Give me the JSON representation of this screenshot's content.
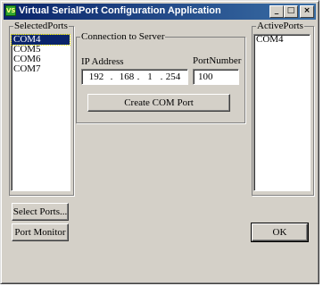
{
  "window": {
    "title": "Virtual SerialPort Configuration Application",
    "icon_text": "VS"
  },
  "title_buttons": {
    "minimize": "_",
    "maximize": "□",
    "close": "×"
  },
  "selected_ports": {
    "label": "SelectedPorts",
    "items": [
      "COM4",
      "COM5",
      "COM6",
      "COM7"
    ],
    "selected_index": 0
  },
  "connection": {
    "label": "Connection to Server",
    "ip_label": "IP Address",
    "ip": [
      "192",
      "168",
      "1",
      "254"
    ],
    "ip_dot": ".",
    "port_label": "PortNumber",
    "port": "100",
    "create_button": "Create COM Port"
  },
  "active_ports": {
    "label": "ActivePorts",
    "items": [
      "COM4"
    ]
  },
  "buttons": {
    "select_ports": "Select Ports...",
    "port_monitor": "Port Monitor",
    "ok": "OK"
  },
  "colors": {
    "face": "#d4d0c8",
    "title_start": "#0a246a",
    "title_end": "#3a6ea5",
    "selection": "#0a246a"
  }
}
